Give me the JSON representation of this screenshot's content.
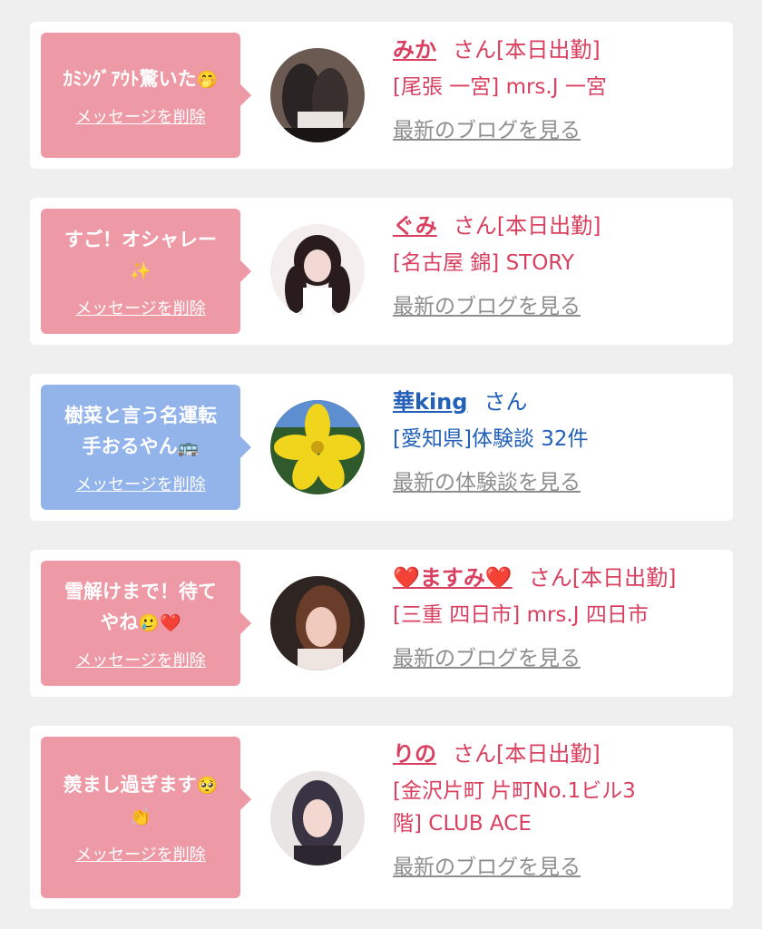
{
  "cards": [
    {
      "message": "ｶﾐﾝｸﾞｱｳﾄ驚いた",
      "message_emoji": "🤭",
      "delete_label": "メッセージを削除",
      "name": "みか",
      "name_suffix": "さん[本日出勤]",
      "detail": "[尾張 一宮] mrs.J 一宮",
      "link": "最新のブログを見る"
    },
    {
      "message": "すご！オシャレー",
      "message_emoji": "✨",
      "delete_label": "メッセージを削除",
      "name": "ぐみ",
      "name_suffix": "さん[本日出勤]",
      "detail": "[名古屋 錦] STORY",
      "link": "最新のブログを見る"
    },
    {
      "message": "樹菜と言う名運転\n手おるやん",
      "message_emoji": "🚌",
      "delete_label": "メッセージを削除",
      "name": "華king",
      "name_suffix": "さん",
      "detail": "[愛知県]体験談 32件",
      "link": "最新の体験談を見る"
    },
    {
      "message": "雪解けまで！待て\nやね",
      "message_emoji": "🥲❤️",
      "delete_label": "メッセージを削除",
      "name": "❤️ますみ❤️",
      "name_suffix": "さん[本日出勤]",
      "detail": "[三重 四日市] mrs.J 四日市",
      "link": "最新のブログを見る"
    },
    {
      "message": "羨まし過ぎます",
      "message_emoji": "🥺\n👏",
      "delete_label": "メッセージを削除",
      "name": "りの",
      "name_suffix": "さん[本日出勤]",
      "detail": "[金沢片町 片町No.1ビル3\n階] CLUB ACE",
      "link": "最新のブログを見る"
    }
  ],
  "colors": {
    "pink_bubble": "#ee99a6",
    "blue_bubble": "#92b4ea",
    "pink_text": "#d94060",
    "blue_text": "#2260b8",
    "link_gray": "#8e8e8e"
  }
}
